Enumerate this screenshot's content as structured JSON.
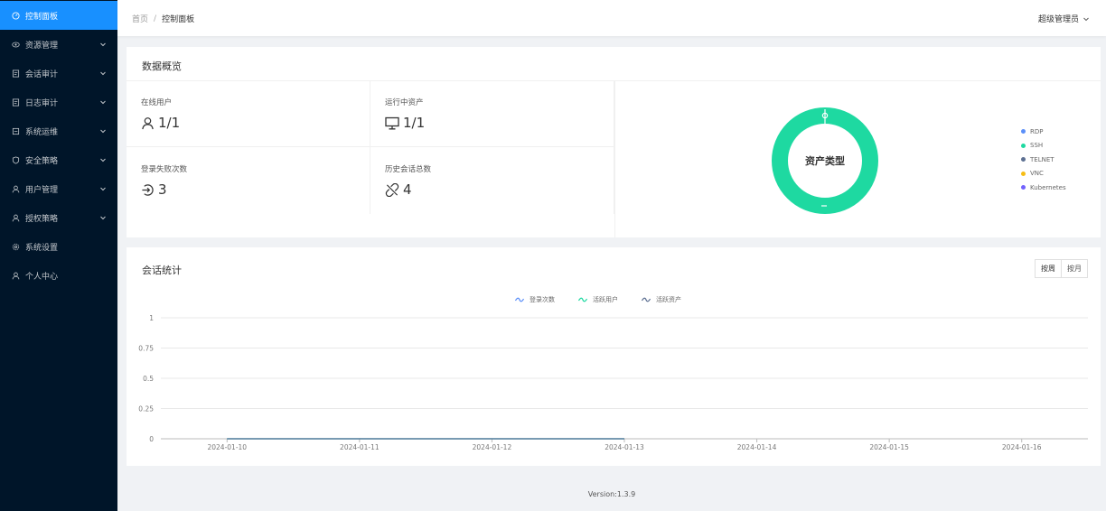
{
  "sidebar": {
    "items": [
      {
        "label": "控制面板",
        "icon": "dashboard-icon",
        "active": true,
        "has_arrow": false
      },
      {
        "label": "资源管理",
        "icon": "eye-icon",
        "active": false,
        "has_arrow": true
      },
      {
        "label": "会话审计",
        "icon": "file-icon",
        "active": false,
        "has_arrow": true
      },
      {
        "label": "日志审计",
        "icon": "file-icon",
        "active": false,
        "has_arrow": true
      },
      {
        "label": "系统运维",
        "icon": "tool-icon",
        "active": false,
        "has_arrow": true
      },
      {
        "label": "安全策略",
        "icon": "shield-icon",
        "active": false,
        "has_arrow": true
      },
      {
        "label": "用户管理",
        "icon": "user-icon",
        "active": false,
        "has_arrow": true
      },
      {
        "label": "授权策略",
        "icon": "user-icon",
        "active": false,
        "has_arrow": true
      },
      {
        "label": "系统设置",
        "icon": "gear-icon",
        "active": false,
        "has_arrow": false
      },
      {
        "label": "个人中心",
        "icon": "user-icon",
        "active": false,
        "has_arrow": false
      }
    ]
  },
  "header": {
    "breadcrumb_home": "首页",
    "breadcrumb_sep": "/",
    "breadcrumb_current": "控制面板",
    "user": "超级管理员"
  },
  "overview": {
    "title": "数据概览",
    "stats": [
      {
        "label": "在线用户",
        "value": "1/1",
        "icon": "user-icon"
      },
      {
        "label": "运行中资产",
        "value": "1/1",
        "icon": "desktop-icon"
      },
      {
        "label": "登录失败次数",
        "value": "3",
        "icon": "login-icon"
      },
      {
        "label": "历史会话总数",
        "value": "4",
        "icon": "disconnect-icon"
      }
    ],
    "donut_label": "资产类型",
    "legend": [
      {
        "label": "RDP",
        "color": "#5b8ff9"
      },
      {
        "label": "SSH",
        "color": "#1ed9a1"
      },
      {
        "label": "TELNET",
        "color": "#5d7092"
      },
      {
        "label": "VNC",
        "color": "#f6bd16"
      },
      {
        "label": "Kubernetes",
        "color": "#7262fd"
      }
    ]
  },
  "sessions": {
    "title": "会话统计",
    "toggle": [
      {
        "label": "按周",
        "active": true
      },
      {
        "label": "按月",
        "active": false
      }
    ],
    "legend": [
      {
        "label": "登录次数",
        "color": "#5b8ff9"
      },
      {
        "label": "活跃用户",
        "color": "#1ed9a1"
      },
      {
        "label": "活跃资产",
        "color": "#5d7092"
      }
    ]
  },
  "chart_data": {
    "type": "line",
    "x": [
      "2024-01-10",
      "2024-01-11",
      "2024-01-12",
      "2024-01-13",
      "2024-01-14",
      "2024-01-15",
      "2024-01-16"
    ],
    "yticks": [
      "1",
      "0.75",
      "0.5",
      "0.25",
      "0"
    ],
    "ylim": [
      0,
      1
    ],
    "series": [
      {
        "name": "登录次数",
        "values": [
          0,
          0,
          0,
          0
        ],
        "color": "#5b8ff9"
      },
      {
        "name": "活跃用户",
        "values": [
          0,
          0,
          0,
          0
        ],
        "color": "#1ed9a1"
      },
      {
        "name": "活跃资产",
        "values": [
          0,
          0,
          0,
          0
        ],
        "color": "#5d7092"
      }
    ]
  },
  "footer": {
    "version": "Version:1.3.9"
  }
}
